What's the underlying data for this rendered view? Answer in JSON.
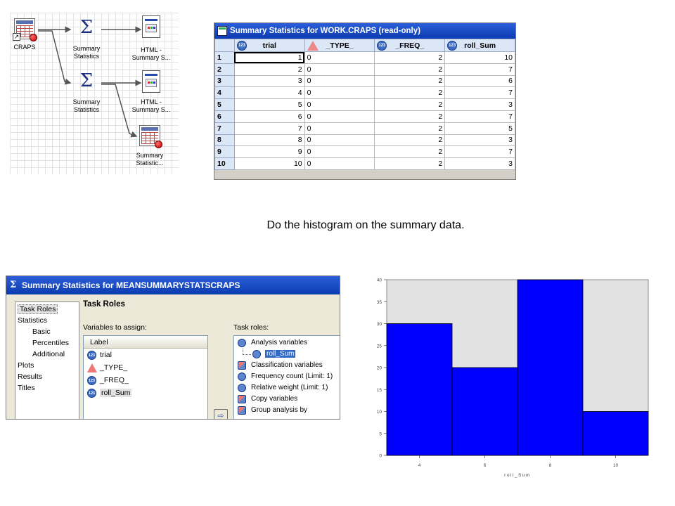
{
  "flow": {
    "nodes": [
      {
        "id": "craps",
        "label": "CRAPS",
        "icon": "table-icon"
      },
      {
        "id": "ss1",
        "label": "Summary Statistics",
        "icon": "sigma-icon"
      },
      {
        "id": "html1",
        "label": "HTML - Summary S...",
        "icon": "html-report-icon"
      },
      {
        "id": "ss2",
        "label": "Summary Statistics",
        "icon": "sigma-icon"
      },
      {
        "id": "html2",
        "label": "HTML - Summary S...",
        "icon": "html-report-icon"
      },
      {
        "id": "out",
        "label": "Summary Statistic...",
        "icon": "table-icon"
      }
    ]
  },
  "grid": {
    "title": "Summary Statistics for WORK.CRAPS (read-only)",
    "columns": [
      "trial",
      "_TYPE_",
      "_FREQ_",
      "roll_Sum"
    ],
    "rows": [
      {
        "n": "1",
        "trial": "1",
        "type": "0",
        "freq": "2",
        "sum": "10"
      },
      {
        "n": "2",
        "trial": "2",
        "type": "0",
        "freq": "2",
        "sum": "7"
      },
      {
        "n": "3",
        "trial": "3",
        "type": "0",
        "freq": "2",
        "sum": "6"
      },
      {
        "n": "4",
        "trial": "4",
        "type": "0",
        "freq": "2",
        "sum": "7"
      },
      {
        "n": "5",
        "trial": "5",
        "type": "0",
        "freq": "2",
        "sum": "3"
      },
      {
        "n": "6",
        "trial": "6",
        "type": "0",
        "freq": "2",
        "sum": "7"
      },
      {
        "n": "7",
        "trial": "7",
        "type": "0",
        "freq": "2",
        "sum": "5"
      },
      {
        "n": "8",
        "trial": "8",
        "type": "0",
        "freq": "2",
        "sum": "3"
      },
      {
        "n": "9",
        "trial": "9",
        "type": "0",
        "freq": "2",
        "sum": "7"
      },
      {
        "n": "10",
        "trial": "10",
        "type": "0",
        "freq": "2",
        "sum": "3"
      }
    ]
  },
  "caption": "Do the histogram on the summary data.",
  "dialog": {
    "title": "Summary Statistics for MEANSUMMARYSTATSCRAPS",
    "nav": [
      {
        "label": "Task Roles",
        "level": 0,
        "selected": true
      },
      {
        "label": "Statistics",
        "level": 0
      },
      {
        "label": "Basic",
        "level": 1
      },
      {
        "label": "Percentiles",
        "level": 1
      },
      {
        "label": "Additional",
        "level": 1
      },
      {
        "label": "Plots",
        "level": 0
      },
      {
        "label": "Results",
        "level": 0
      },
      {
        "label": "Titles",
        "level": 0
      }
    ],
    "section_title": "Task Roles",
    "vars_label": "Variables to assign:",
    "vars_col": "Label",
    "variables": [
      {
        "label": "trial",
        "type": "numeric"
      },
      {
        "label": "_TYPE_",
        "type": "character"
      },
      {
        "label": "_FREQ_",
        "type": "numeric"
      },
      {
        "label": "roll_Sum",
        "type": "numeric",
        "highlight": true
      }
    ],
    "roles_label": "Task roles:",
    "roles": [
      {
        "label": "Analysis variables",
        "child": false,
        "dual": false
      },
      {
        "label": "roll_Sum",
        "child": true,
        "dual": false
      },
      {
        "label": "Classification variables",
        "child": false,
        "dual": true
      },
      {
        "label": "Frequency count  (Limit: 1)",
        "child": false,
        "dual": false
      },
      {
        "label": "Relative weight  (Limit: 1)",
        "child": false,
        "dual": false
      },
      {
        "label": "Copy variables",
        "child": false,
        "dual": true
      },
      {
        "label": "Group analysis by",
        "child": false,
        "dual": true
      }
    ],
    "move_glyph": "⇨"
  },
  "chart_data": {
    "type": "bar",
    "xlabel": "roll_Sum",
    "ylabel": "",
    "bins": [
      {
        "from": 3,
        "to": 5,
        "value": 30
      },
      {
        "from": 5,
        "to": 7,
        "value": 20
      },
      {
        "from": 7,
        "to": 9,
        "value": 40
      },
      {
        "from": 9,
        "to": 11,
        "value": 10
      }
    ],
    "x_ticks": [
      4,
      6,
      8,
      10
    ],
    "xlim": [
      3,
      11
    ],
    "y_ticks": [
      0,
      5,
      10,
      15,
      20,
      25,
      30,
      35,
      40
    ],
    "ylim": [
      0,
      40
    ],
    "bar_color": "#0000ff",
    "background_color": "#e2e2e2"
  }
}
